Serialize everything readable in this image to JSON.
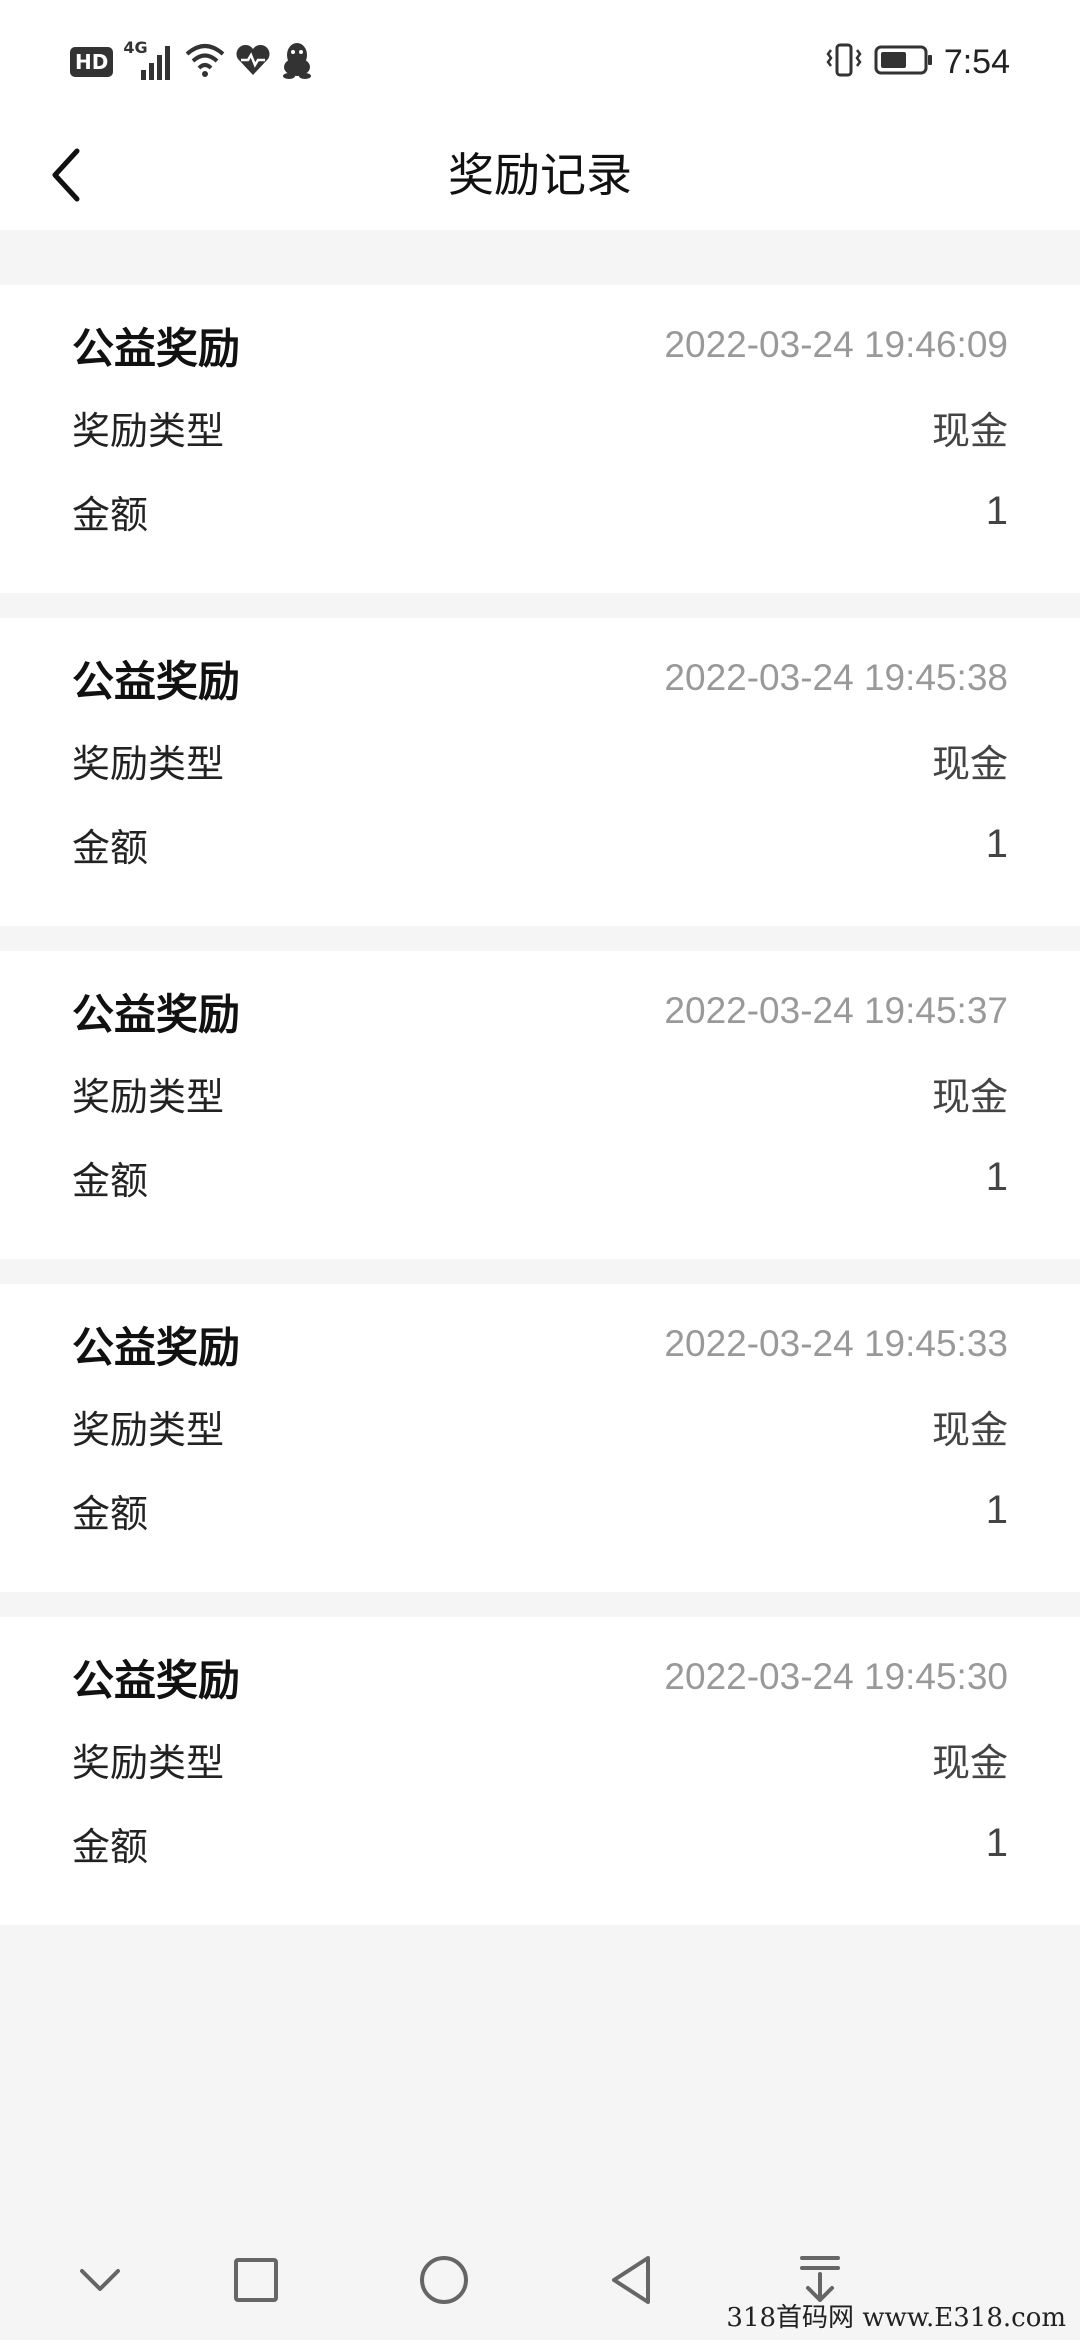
{
  "status_bar": {
    "hd_badge": "HD",
    "network": "4G",
    "time": "7:54"
  },
  "header": {
    "title": "奖励记录"
  },
  "records": [
    {
      "title": "公益奖励",
      "time": "2022-03-24 19:46:09",
      "type_label": "奖励类型",
      "type_value": "现金",
      "amount_label": "金额",
      "amount_value": "1"
    },
    {
      "title": "公益奖励",
      "time": "2022-03-24 19:45:38",
      "type_label": "奖励类型",
      "type_value": "现金",
      "amount_label": "金额",
      "amount_value": "1"
    },
    {
      "title": "公益奖励",
      "time": "2022-03-24 19:45:37",
      "type_label": "奖励类型",
      "type_value": "现金",
      "amount_label": "金额",
      "amount_value": "1"
    },
    {
      "title": "公益奖励",
      "time": "2022-03-24 19:45:33",
      "type_label": "奖励类型",
      "type_value": "现金",
      "amount_label": "金额",
      "amount_value": "1"
    },
    {
      "title": "公益奖励",
      "time": "2022-03-24 19:45:30",
      "type_label": "奖励类型",
      "type_value": "现金",
      "amount_label": "金额",
      "amount_value": "1"
    }
  ],
  "nav_bar": {
    "icons": [
      "chevron-down-icon",
      "square-icon",
      "circle-icon",
      "triangle-back-icon",
      "download-arrow-icon"
    ]
  },
  "watermark": "318首码网 www.E318.com",
  "colors": {
    "page_bg": "#f5f5f5",
    "card_bg": "#ffffff",
    "primary_text": "#111111",
    "secondary_text": "#999999"
  }
}
